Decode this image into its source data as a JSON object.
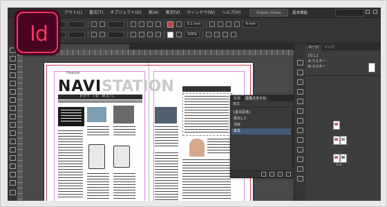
{
  "logo": {
    "text": "Id"
  },
  "menubar": {
    "items": [
      "アウト(L)",
      "書式(T)",
      "オブジェクト(O)",
      "表(A)",
      "表示(V)",
      "ウィンドウ(W)",
      "ヘルプ(H)"
    ],
    "center_button": "Publish Online",
    "workspace": "基本機能"
  },
  "control": {
    "stroke_weight": "0.1 mm",
    "zoom": "100%",
    "width_value": "4 mm"
  },
  "document": {
    "tab_title": ""
  },
  "page": {
    "small_header": "Feature",
    "headline_black": "NAVI",
    "headline_gray": "STATION",
    "sub_band": "EPT IN MAIL"
  },
  "paragraph_styles_panel": {
    "tabs": [
      "段落",
      "段落スタイル"
    ],
    "active_tab_index": 1,
    "current": "本文",
    "items": [
      "[基本段落]",
      "見出し1",
      "項目",
      "本文"
    ],
    "selected_index": 3
  },
  "pages_panel": {
    "tabs": [
      "ページ",
      "リンク"
    ],
    "masters": [
      "[なし]",
      "A-マスター",
      "B-マスター"
    ],
    "spread_label": "3–4"
  },
  "colors": {
    "brand": "#FF3366",
    "logo_bg": "#49021F",
    "selection": "#455A78"
  }
}
